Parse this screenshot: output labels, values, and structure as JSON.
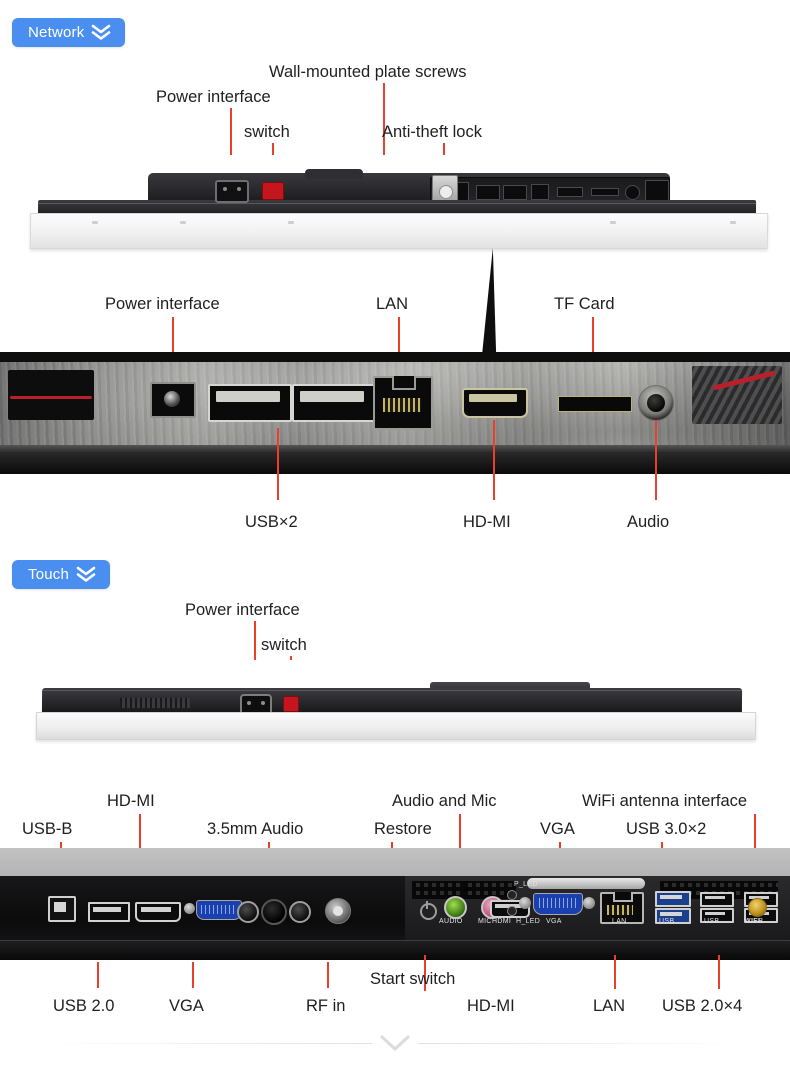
{
  "sections": [
    {
      "badge": {
        "label": "Network",
        "icon": "double-chevron-down-icon",
        "color": "#4a8ff0"
      },
      "photo_top": {
        "labels_above": [
          {
            "text": "Power interface"
          },
          {
            "text": "switch"
          },
          {
            "text": "Wall-mounted plate screws"
          },
          {
            "text": "Anti-theft lock"
          }
        ]
      },
      "photo_ports": {
        "labels_above": [
          {
            "text": "Power interface"
          },
          {
            "text": "LAN"
          },
          {
            "text": "TF Card"
          }
        ],
        "labels_below": [
          {
            "text": "USB×2"
          },
          {
            "text": "HD-MI"
          },
          {
            "text": "Audio"
          }
        ]
      }
    },
    {
      "badge": {
        "label": "Touch",
        "icon": "double-chevron-down-icon",
        "color": "#4a8ff0"
      },
      "photo_top": {
        "labels_above": [
          {
            "text": "Power interface"
          },
          {
            "text": "switch"
          }
        ]
      },
      "photo_io": {
        "labels_above": [
          {
            "text": "USB-B"
          },
          {
            "text": "HD-MI"
          },
          {
            "text": "3.5mm Audio"
          },
          {
            "text": "Restore"
          },
          {
            "text": "Audio and Mic"
          },
          {
            "text": "VGA"
          },
          {
            "text": "USB 3.0×2"
          },
          {
            "text": "WiFi antenna interface"
          }
        ],
        "labels_below": [
          {
            "text": "USB 2.0"
          },
          {
            "text": "VGA"
          },
          {
            "text": "RF in"
          },
          {
            "text": "Start switch"
          },
          {
            "text": "HD-MI"
          },
          {
            "text": "LAN"
          },
          {
            "text": "USB 2.0×4"
          }
        ],
        "silkscreen": [
          {
            "text": "AUDIO"
          },
          {
            "text": "MIC"
          },
          {
            "text": "HDMI"
          },
          {
            "text": "H_LED"
          },
          {
            "text": "P_LED"
          },
          {
            "text": "VGA"
          },
          {
            "text": "LAN"
          },
          {
            "text": "USB"
          },
          {
            "text": "USB"
          },
          {
            "text": "USB"
          },
          {
            "text": "WIFI"
          }
        ]
      }
    }
  ],
  "footer": {
    "icon": "chevron-down-icon"
  },
  "colors": {
    "accent_blue": "#4a8ff0",
    "leader_red": "#e8402a",
    "text": "#1f1f1f"
  }
}
